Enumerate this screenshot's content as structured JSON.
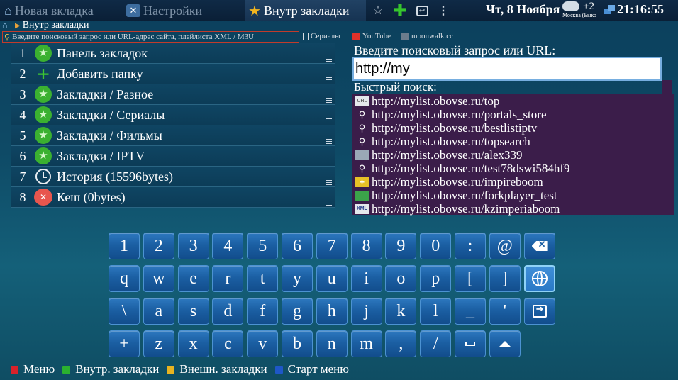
{
  "tabs": {
    "new_tab": "Новая вкладка",
    "settings": "Настройки",
    "bookmarks": "Внутр закладки"
  },
  "status": {
    "date": "Чт, 8 Ноября",
    "weather_temp": "+2",
    "weather_city": "Москва (Быко",
    "time": "21:16:55"
  },
  "breadcrumb": {
    "current": "Внутр закладки"
  },
  "address": {
    "placeholder": "Введите поисковый запрос или URL-адрес сайта, плейлиста XML / M3U",
    "links": [
      "Сериалы",
      "YouTube",
      "moonwalk.cc"
    ]
  },
  "bookmarks": [
    {
      "num": "1",
      "label": "Панель закладок",
      "icon": "star-icon"
    },
    {
      "num": "2",
      "label": "Добавить папку",
      "icon": "plus-icon"
    },
    {
      "num": "3",
      "label": "Закладки / Разное",
      "icon": "star-icon"
    },
    {
      "num": "4",
      "label": "Закладки / Сериалы",
      "icon": "star-icon"
    },
    {
      "num": "5",
      "label": "Закладки / Фильмы",
      "icon": "star-icon"
    },
    {
      "num": "6",
      "label": "Закладки / IPTV",
      "icon": "star-icon"
    },
    {
      "num": "7",
      "label": "История (15596bytes)",
      "icon": "clock-icon"
    },
    {
      "num": "8",
      "label": "Кеш (0bytes)",
      "icon": "cache-icon"
    }
  ],
  "search": {
    "title": "Введите поисковый запрос или URL:",
    "value": "http://my",
    "quick_title": "Быстрый поиск:",
    "results": [
      {
        "icon": "url-icon",
        "text": "http://mylist.obovse.ru/top"
      },
      {
        "icon": "search-icon",
        "text": "http://mylist.obovse.ru/portals_store"
      },
      {
        "icon": "search-icon",
        "text": "http://mylist.obovse.ru/bestlistiptv"
      },
      {
        "icon": "search-icon",
        "text": "http://mylist.obovse.ru/topsearch"
      },
      {
        "icon": "film-icon",
        "text": "http://mylist.obovse.ru/alex339"
      },
      {
        "icon": "search-icon",
        "text": "http://mylist.obovse.ru/test78dswi584hf9"
      },
      {
        "icon": "plus-icon",
        "text": "http://mylist.obovse.ru/impireboom"
      },
      {
        "icon": "app-icon",
        "text": "http://mylist.obovse.ru/forkplayer_test"
      },
      {
        "icon": "xml-icon",
        "text": "http://mylist.obovse.ru/kzimperiaboom"
      }
    ]
  },
  "keyboard": {
    "rows": [
      [
        "1",
        "2",
        "3",
        "4",
        "5",
        "6",
        "7",
        "8",
        "9",
        "0",
        ":",
        "@",
        "backspace"
      ],
      [
        "q",
        "w",
        "e",
        "r",
        "t",
        "y",
        "u",
        "i",
        "o",
        "p",
        "[",
        "]",
        "language"
      ],
      [
        "\\",
        "a",
        "s",
        "d",
        "f",
        "g",
        "h",
        "j",
        "k",
        "l",
        "_",
        "'",
        "enter"
      ],
      [
        "+",
        "z",
        "x",
        "c",
        "v",
        "b",
        "n",
        "m",
        ",",
        "/",
        "space",
        "shift"
      ]
    ]
  },
  "footer": [
    {
      "label": "Меню",
      "color": "#d8222a"
    },
    {
      "label": "Внутр. закладки",
      "color": "#2bb12f"
    },
    {
      "label": "Внешн. закладки",
      "color": "#e8b321"
    },
    {
      "label": "Старт меню",
      "color": "#1e57c8"
    }
  ],
  "colors": {
    "accent_input_border": "#76aee0",
    "quick_list_bg": "#3b1d4a",
    "key_bg": "#1b5fa3"
  }
}
